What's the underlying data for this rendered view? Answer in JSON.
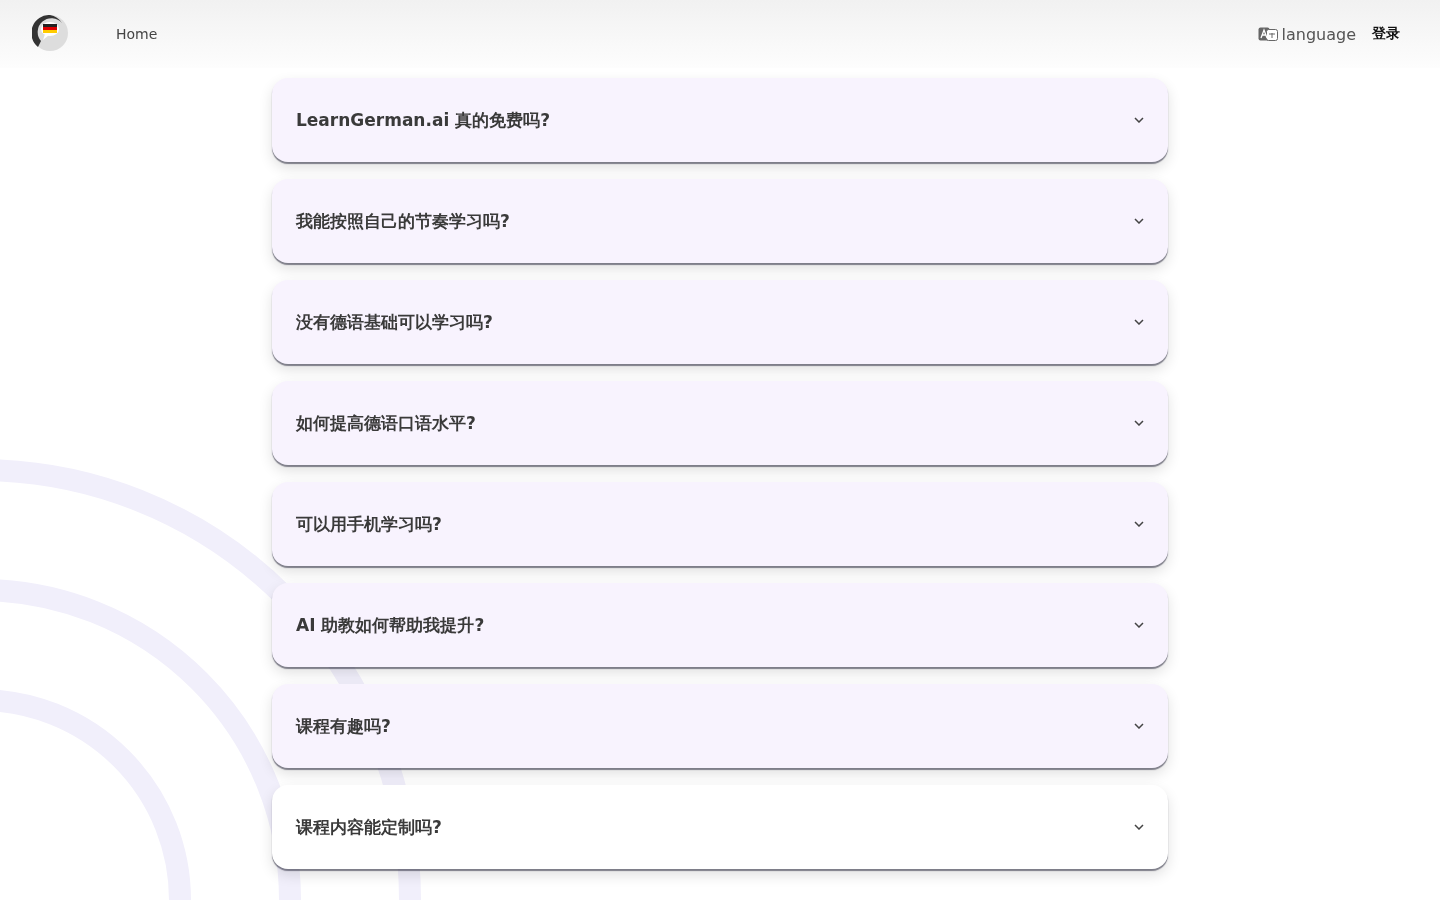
{
  "header": {
    "nav": [
      {
        "label": "Home"
      }
    ],
    "language": {
      "label": "language"
    },
    "login": {
      "label": "登录"
    }
  },
  "faq": [
    {
      "question": "LearnGerman.ai 真的免费吗?",
      "color": "#f8f3fe"
    },
    {
      "question": "我能按照自己的节奏学习吗?",
      "color": "#f8f3fe"
    },
    {
      "question": "没有德语基础可以学习吗?",
      "color": "#f8f3fe"
    },
    {
      "question": "如何提高德语口语水平?",
      "color": "#f8f3fe"
    },
    {
      "question": "可以用手机学习吗?",
      "color": "#f8f3fe"
    },
    {
      "question": "AI 助教如何帮助我提升?",
      "color": "#f8f3fe"
    },
    {
      "question": "课程有趣吗?",
      "color": "#f8f3fe"
    },
    {
      "question": "课程内容能定制吗?",
      "color": "#ffffff"
    }
  ]
}
